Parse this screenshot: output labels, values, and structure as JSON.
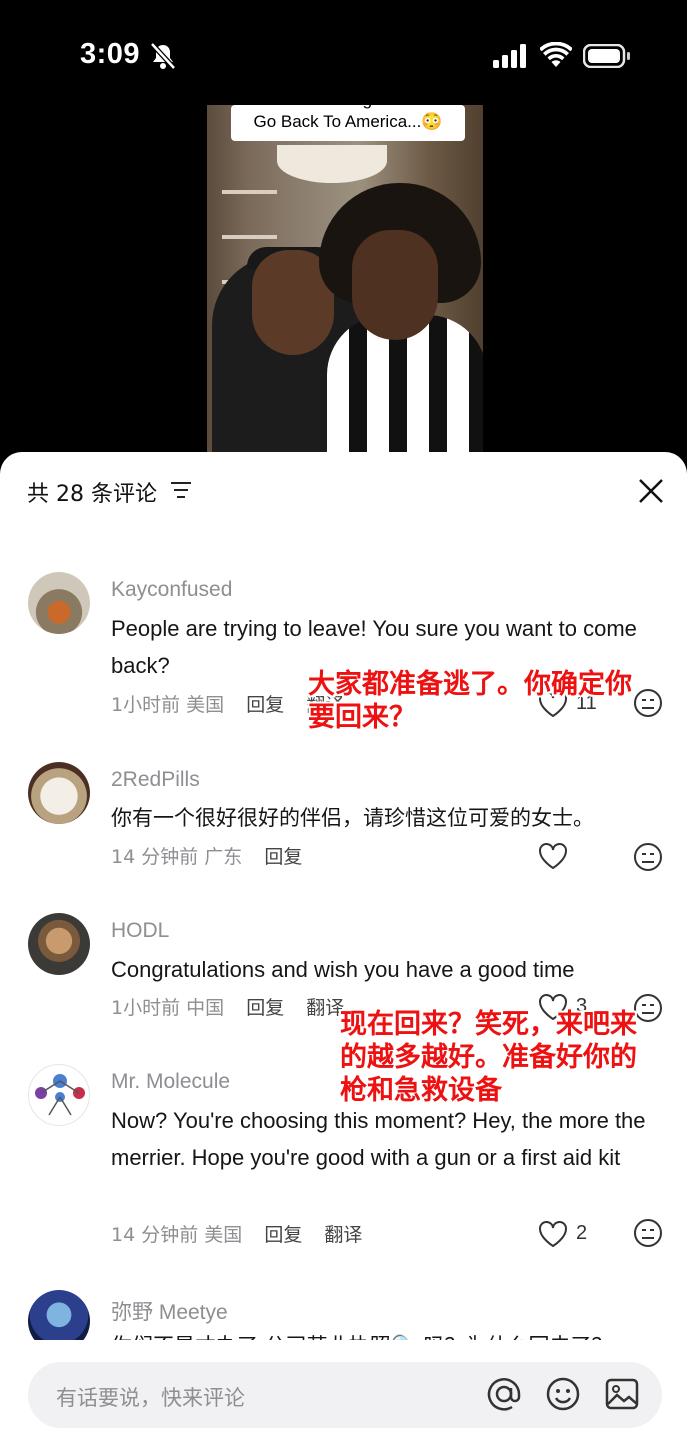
{
  "status_bar": {
    "time": "3:09"
  },
  "video": {
    "caption_top": "We Are Leaving China To",
    "caption": "Go Back To America...😳"
  },
  "sheet": {
    "title": "共 28 条评论",
    "comments": [
      {
        "username": "Kayconfused",
        "text": "People are trying to leave!   You sure you want to come back?",
        "time": "1小时前",
        "location": "美国",
        "reply": "回复",
        "translate": "翻译",
        "likes": "11"
      },
      {
        "username": "2RedPills",
        "text": "你有一个很好很好的伴侣，请珍惜这位可爱的女士。",
        "time": "14 分钟前",
        "location": "广东",
        "reply": "回复",
        "likes": ""
      },
      {
        "username": "HODL",
        "text": "Congratulations and wish you have a good time",
        "time": "1小时前",
        "location": "中国",
        "reply": "回复",
        "translate": "翻译",
        "likes": "3"
      },
      {
        "username": "Mr. Molecule",
        "text": "Now? You're choosing this moment? Hey, the more the merrier. Hope you're good with a gun or a first aid kit",
        "time": "14 分钟前",
        "location": "美国",
        "reply": "回复",
        "translate": "翻译",
        "likes": "2"
      },
      {
        "username": "弥野 Meetye",
        "text": "你们不是才办了 公司营业执照🔍 吗？为什么回去了？"
      }
    ],
    "overlays": [
      "大家都准备逃了。你确定你要回来？",
      "现在回来？笑死，来吧来的越多越好。准备好你的枪和急救设备"
    ]
  },
  "input": {
    "placeholder": "有话要说，快来评论"
  }
}
